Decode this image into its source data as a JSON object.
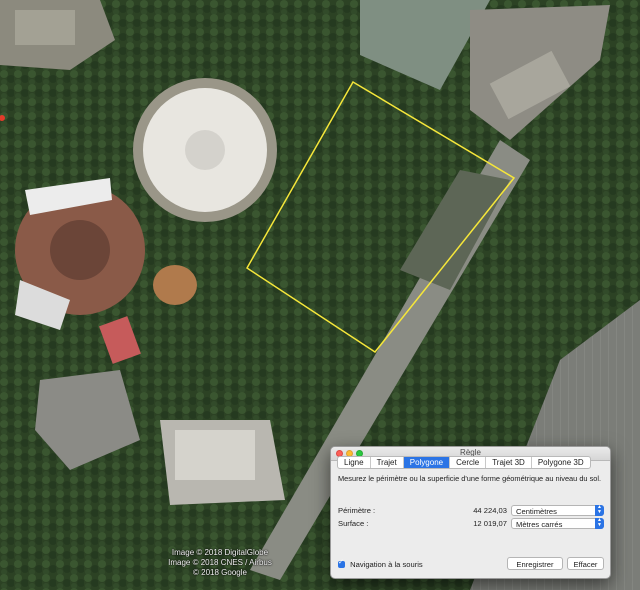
{
  "map": {
    "credits": [
      "Image © 2018 DigitalGlobe",
      "Image © 2018 CNES / Airbus",
      "© 2018 Google"
    ],
    "polygon_color": "#f5e63a"
  },
  "ruler": {
    "window_title": "Règle",
    "tabs": [
      "Ligne",
      "Trajet",
      "Polygone",
      "Cercle",
      "Trajet 3D",
      "Polygone 3D"
    ],
    "active_tab": "Polygone",
    "description": "Mesurez le périmètre ou la superficie d'une forme géométrique au niveau du sol.",
    "perimeter": {
      "label": "Périmètre :",
      "value": "44 224,03",
      "unit": "Centimètres"
    },
    "area": {
      "label": "Surface :",
      "value": "12 019,07",
      "unit": "Mètres carrés"
    },
    "mouse_nav": {
      "label": "Navigation à la souris",
      "checked": true
    },
    "save_label": "Enregistrer",
    "clear_label": "Effacer",
    "accent_color": "#2b74e5"
  }
}
